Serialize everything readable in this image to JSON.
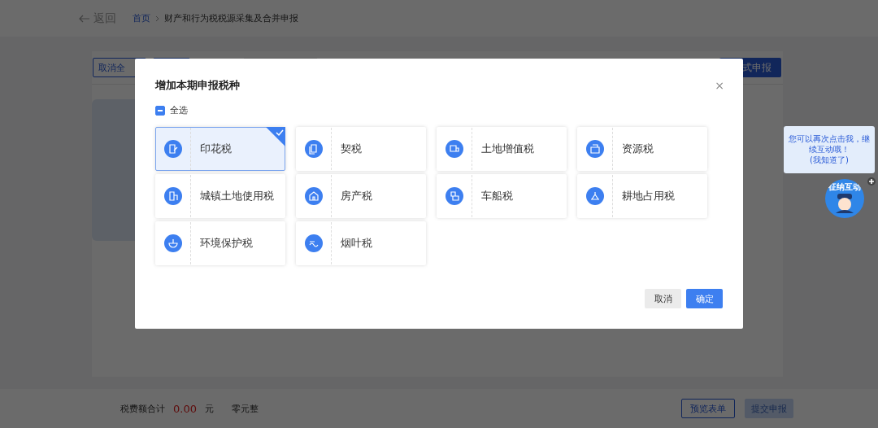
{
  "header": {
    "back": "返回",
    "breadcrumb": [
      {
        "label": "首页",
        "link": true
      },
      {
        "label": "财产和行为税税源采集及合并申报",
        "link": false
      }
    ]
  },
  "toolbar": {
    "deselect_all": "取消全",
    "submit": "式申报"
  },
  "dialog": {
    "title": "增加本期申报税种",
    "close": "×",
    "select_all": {
      "label": "全选",
      "indeterminate": true
    },
    "taxes": [
      {
        "name": "印花税",
        "selected": true
      },
      {
        "name": "契税",
        "selected": false
      },
      {
        "name": "土地增值税",
        "selected": false
      },
      {
        "name": "资源税",
        "selected": false
      },
      {
        "name": "城镇土地使用税",
        "selected": false
      },
      {
        "name": "房产税",
        "selected": false
      },
      {
        "name": "车船税",
        "selected": false
      },
      {
        "name": "耕地占用税",
        "selected": false
      },
      {
        "name": "环境保护税",
        "selected": false
      },
      {
        "name": "烟叶税",
        "selected": false
      }
    ],
    "buttons": [
      {
        "label": "取消",
        "kind": "secondary"
      },
      {
        "label": "确定",
        "kind": "primary"
      }
    ]
  },
  "footer": {
    "total_label": "税费额合计",
    "amount": "0.00",
    "unit": "元",
    "amount_words": "零元整",
    "buttons": [
      {
        "label": "预览表单",
        "disabled": false
      },
      {
        "label": "提交申报",
        "disabled": true
      }
    ]
  },
  "assistant": {
    "tip": "您可以再次点击我，继续互动哦！",
    "dismiss": "(我知道了)",
    "badge": "征纳互动"
  }
}
